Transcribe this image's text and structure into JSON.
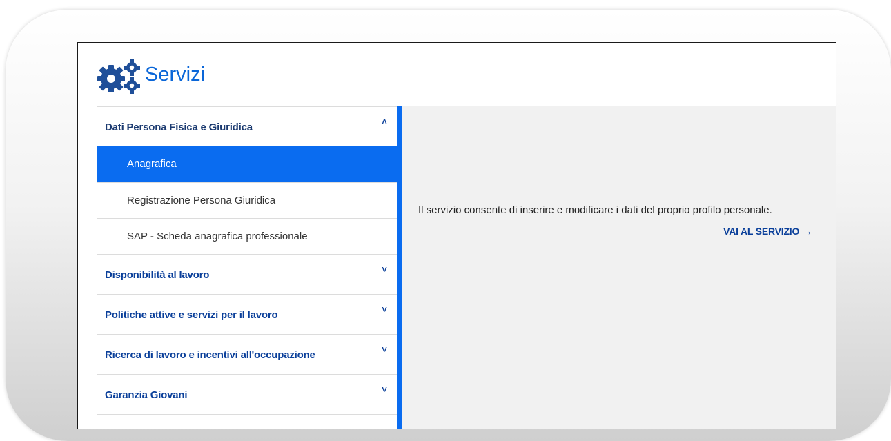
{
  "header": {
    "title": "Servizi",
    "icon": "gears-icon"
  },
  "sidebar": {
    "sections": [
      {
        "label": "Dati Persona Fisica e Giuridica",
        "expanded": true,
        "chevron": "˄",
        "items": [
          {
            "label": "Anagrafica",
            "active": true
          },
          {
            "label": "Registrazione Persona Giuridica",
            "active": false
          },
          {
            "label": "SAP - Scheda anagrafica professionale",
            "active": false
          }
        ]
      },
      {
        "label": "Disponibilità al lavoro",
        "expanded": false,
        "chevron": "˅"
      },
      {
        "label": "Politiche attive e servizi per il lavoro",
        "expanded": false,
        "chevron": "˅"
      },
      {
        "label": "Ricerca di lavoro e incentivi all'occupazione",
        "expanded": false,
        "chevron": "˅"
      },
      {
        "label": "Garanzia Giovani",
        "expanded": false,
        "chevron": "˅"
      }
    ]
  },
  "main": {
    "description": "Il servizio consente di inserire e modificare i dati del proprio profilo personale.",
    "link_label": "VAI AL SERVIZIO",
    "link_arrow": "→"
  },
  "colors": {
    "accent": "#0a6cf0",
    "link": "#0a3f9a",
    "title": "#0a66d8",
    "content_bg": "#f1f1f1"
  }
}
